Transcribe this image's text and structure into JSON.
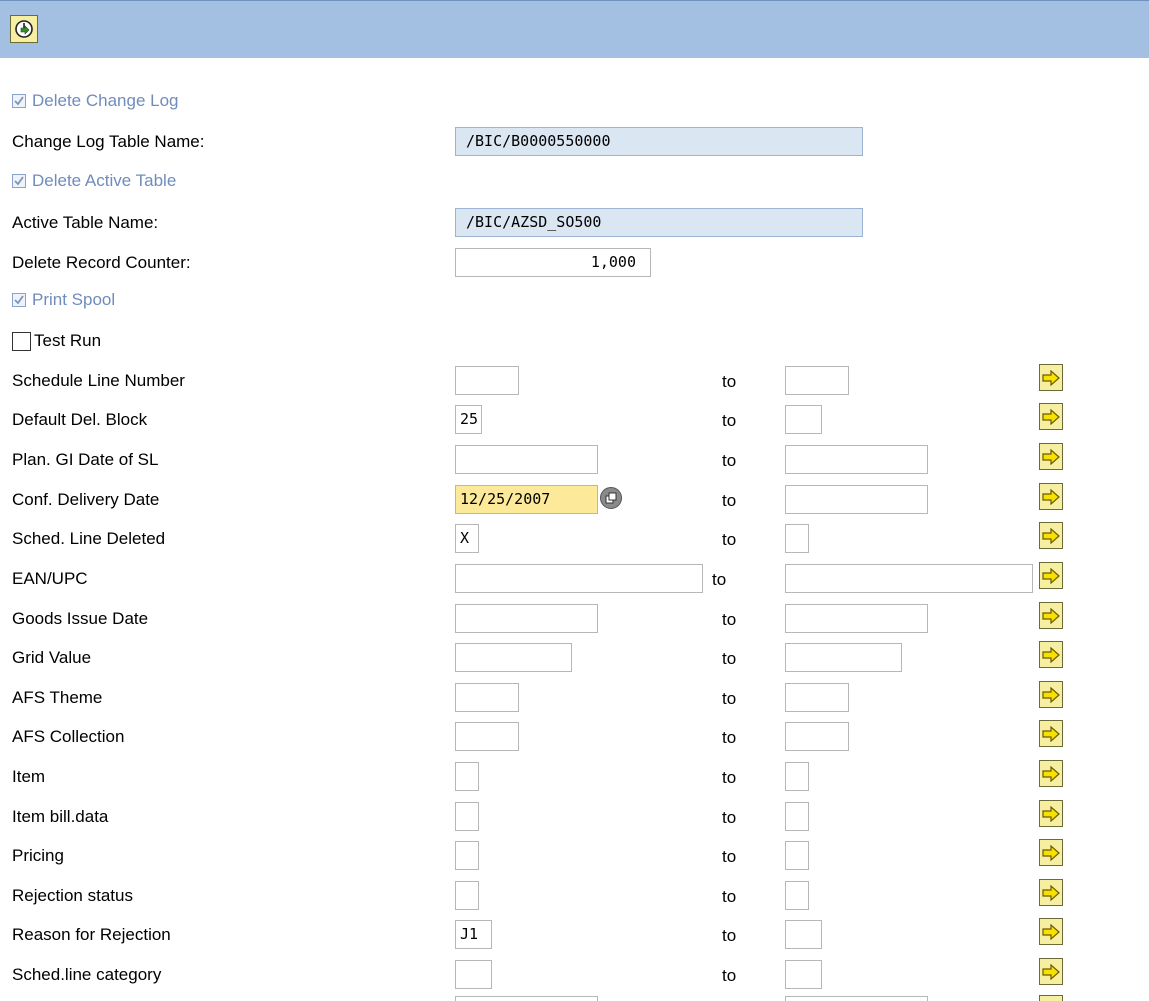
{
  "toolbar": {
    "execute_icon": "execute-clock-icon"
  },
  "options": {
    "delete_change_log": "Delete Change Log",
    "change_log_table_label": "Change Log Table Name:",
    "change_log_table_value": "/BIC/B0000550000",
    "delete_active_table": "Delete Active Table",
    "active_table_label": "Active Table Name:",
    "active_table_value": "/BIC/AZSD_SO500",
    "delete_record_counter_label": "Delete Record Counter:",
    "delete_record_counter_value": "1,000",
    "print_spool": "Print Spool",
    "test_run": "Test Run"
  },
  "to_label": "to",
  "rows": [
    {
      "label": "Schedule Line Number",
      "from": "",
      "to": ""
    },
    {
      "label": "Default Del. Block",
      "from": "25",
      "to": ""
    },
    {
      "label": "Plan. GI Date of SL",
      "from": "",
      "to": ""
    },
    {
      "label": "Conf. Delivery Date",
      "from": "12/25/2007",
      "to": ""
    },
    {
      "label": "Sched. Line Deleted",
      "from": "X",
      "to": ""
    },
    {
      "label": "EAN/UPC",
      "from": "",
      "to": ""
    },
    {
      "label": "Goods Issue Date",
      "from": "",
      "to": ""
    },
    {
      "label": "Grid Value",
      "from": "",
      "to": ""
    },
    {
      "label": "AFS Theme",
      "from": "",
      "to": ""
    },
    {
      "label": "AFS Collection",
      "from": "",
      "to": ""
    },
    {
      "label": "Item",
      "from": "",
      "to": ""
    },
    {
      "label": "Item bill.data",
      "from": "",
      "to": ""
    },
    {
      "label": "Pricing",
      "from": "",
      "to": ""
    },
    {
      "label": "Rejection status",
      "from": "",
      "to": ""
    },
    {
      "label": "Reason for Rejection",
      "from": "J1",
      "to": ""
    },
    {
      "label": "Sched.line category",
      "from": "",
      "to": ""
    }
  ]
}
